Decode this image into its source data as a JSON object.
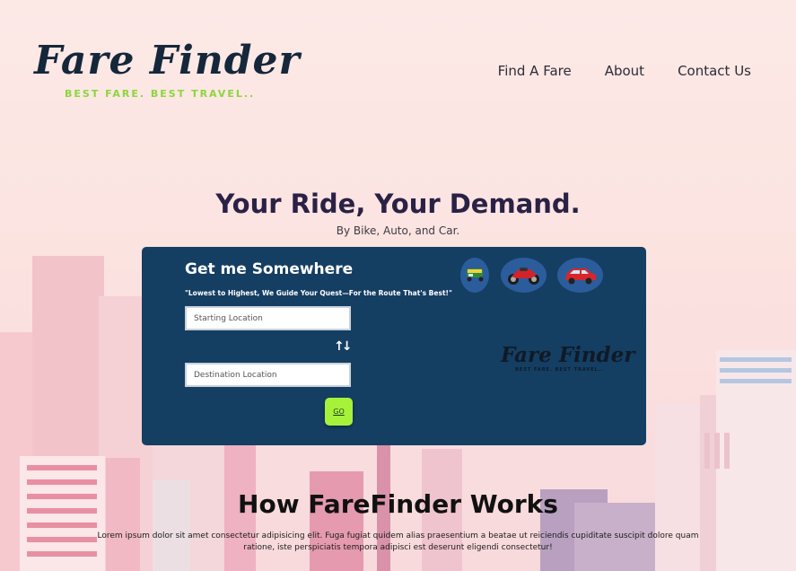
{
  "brand": {
    "name": "Fare Finder",
    "tagline": "BEST FARE. BEST TRAVEL.."
  },
  "nav": {
    "items": [
      {
        "label": "Find A Fare"
      },
      {
        "label": "About"
      },
      {
        "label": "Contact Us"
      }
    ]
  },
  "hero": {
    "title": "Your Ride, Your Demand.",
    "subtitle": "By Bike, Auto, and Car."
  },
  "booking": {
    "title": "Get me Somewhere",
    "quote": "\"Lowest to Highest, We Guide Your Quest—For the Route That's Best!\"",
    "start_placeholder": "Starting Location",
    "start_value": "",
    "dest_placeholder": "Destination Location",
    "dest_value": "",
    "swap_icon": "swap-vertical-icon",
    "go_label": "GO",
    "vehicles": [
      {
        "icon": "auto-rickshaw-icon"
      },
      {
        "icon": "motorbike-icon"
      },
      {
        "icon": "car-icon"
      }
    ]
  },
  "how": {
    "title": "How FareFinder Works",
    "text": "Lorem ipsum dolor sit amet consectetur adipisicing elit. Fuga fugiat quidem alias praesentium a beatae ut reiciendis cupiditate suscipit dolore quam ratione, iste perspiciatis tempora adipisci est deserunt eligendi consectetur!"
  },
  "colors": {
    "panel": "#153e63",
    "accent_green": "#a6f23a",
    "tagline_green": "#8bd63c",
    "heading": "#2a2146"
  }
}
